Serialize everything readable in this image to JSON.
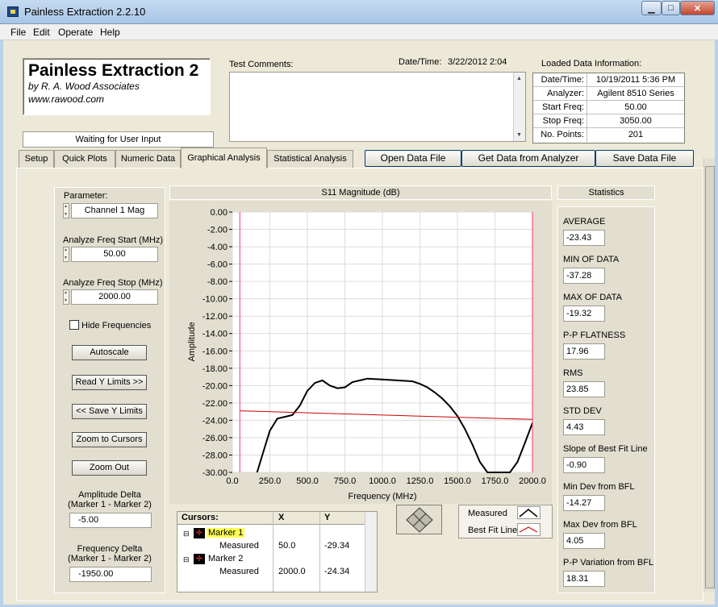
{
  "window": {
    "title": "Painless Extraction 2.2.10",
    "min_icon": "minimize-icon",
    "max_icon": "maximize-icon",
    "close_icon": "close-icon",
    "min": "▁",
    "max": "□",
    "close": "✕"
  },
  "menu": [
    "File",
    "Edit",
    "Operate",
    "Help"
  ],
  "brand": {
    "title": "Painless Extraction 2",
    "by": "by R. A. Wood Associates",
    "url": "www.rawood.com"
  },
  "status": "Waiting for User Input",
  "test_comments_label": "Test Comments:",
  "datetime": {
    "label": "Date/Time:",
    "value": "3/22/2012  2:04"
  },
  "loaded": {
    "label": "Loaded Data Information:",
    "rows": [
      {
        "k": "Date/Time:",
        "v": "10/19/2011 5:36 PM"
      },
      {
        "k": "Analyzer:",
        "v": "Agilent 8510 Series"
      },
      {
        "k": "Start Freq:",
        "v": "50.00"
      },
      {
        "k": "Stop Freq:",
        "v": "3050.00"
      },
      {
        "k": "No. Points:",
        "v": "201"
      }
    ]
  },
  "tabs": [
    "Setup",
    "Quick Plots",
    "Numeric Data",
    "Graphical Analysis",
    "Statistical Analysis"
  ],
  "active_tab": "Graphical Analysis",
  "buttons": {
    "open": "Open Data File",
    "get": "Get Data from Analyzer",
    "save": "Save Data File"
  },
  "left": {
    "parameter_label": "Parameter:",
    "parameter_value": "Channel 1 Mag",
    "start_label": "Analyze Freq Start (MHz)",
    "start_value": "50.00",
    "stop_label": "Analyze Freq Stop (MHz)",
    "stop_value": "2000.00",
    "hide_label": "Hide Frequencies",
    "autoscale": "Autoscale",
    "read_y": "Read Y Limits >>",
    "save_y": "<< Save Y Limits",
    "zoom_cursors": "Zoom to Cursors",
    "zoom_out": "Zoom Out",
    "amp_delta_label1": "Amplitude Delta",
    "amp_delta_label2": "(Marker 1 - Marker 2)",
    "amp_delta_value": "-5.00",
    "freq_delta_label1": "Frequency Delta",
    "freq_delta_label2": "(Marker 1 - Marker 2)",
    "freq_delta_value": "-1950.00"
  },
  "chart_data": {
    "type": "line",
    "title": "S11 Magnitude (dB)",
    "xlabel": "Frequency (MHz)",
    "ylabel": "Amplitude",
    "xlim": [
      0,
      2000
    ],
    "ylim": [
      -30,
      0
    ],
    "xticks": [
      "0.0",
      "250.0",
      "500.0",
      "750.0",
      "1000.0",
      "1250.0",
      "1500.0",
      "1750.0",
      "2000.0"
    ],
    "yticks": [
      "0.00",
      "-2.00",
      "-4.00",
      "-6.00",
      "-8.00",
      "-10.00",
      "-12.00",
      "-14.00",
      "-16.00",
      "-18.00",
      "-20.00",
      "-22.00",
      "-24.00",
      "-26.00",
      "-28.00",
      "-30.00"
    ],
    "grid": true,
    "series": [
      {
        "name": "Measured",
        "color": "#000000",
        "x": [
          165,
          200,
          250,
          300,
          350,
          400,
          450,
          500,
          550,
          600,
          650,
          700,
          750,
          800,
          850,
          900,
          1000,
          1100,
          1200,
          1250,
          1300,
          1350,
          1400,
          1450,
          1500,
          1550,
          1600,
          1650,
          1700,
          1750,
          1800,
          1850,
          1900,
          1950,
          2000
        ],
        "y": [
          -30,
          -28,
          -25.2,
          -23.8,
          -23.6,
          -23.4,
          -22.3,
          -20.6,
          -19.7,
          -19.4,
          -20,
          -20.3,
          -20.2,
          -19.6,
          -19.4,
          -19.2,
          -19.3,
          -19.4,
          -19.5,
          -19.8,
          -20.2,
          -20.8,
          -21.5,
          -22.4,
          -23.5,
          -25,
          -26.8,
          -28.8,
          -30,
          -30,
          -30,
          -30,
          -28.8,
          -26.6,
          -24.3
        ]
      },
      {
        "name": "Best Fit Line",
        "color": "#cc0000",
        "x": [
          50,
          2000
        ],
        "y": [
          -22.9,
          -23.9
        ]
      }
    ],
    "cursors": [
      {
        "name": "Marker 1",
        "x": 50,
        "y": -29.34
      },
      {
        "name": "Marker 2",
        "x": 2000,
        "y": -24.34
      }
    ]
  },
  "cursor_table": {
    "headers": [
      "Cursors:",
      "X",
      "Y"
    ],
    "rows": [
      {
        "name": "Marker 1",
        "sub": "Measured",
        "x": "50.0",
        "y": "-29.34"
      },
      {
        "name": "Marker 2",
        "sub": "Measured",
        "x": "2000.0",
        "y": "-24.34"
      }
    ]
  },
  "legend": [
    {
      "name": "Measured",
      "color": "#000000"
    },
    {
      "name": "Best Fit Line",
      "color": "#cc0000"
    }
  ],
  "stats": {
    "title": "Statistics",
    "items": [
      {
        "label": "AVERAGE",
        "value": "-23.43"
      },
      {
        "label": "MIN OF DATA",
        "value": "-37.28"
      },
      {
        "label": "MAX OF DATA",
        "value": "-19.32"
      },
      {
        "label": "P-P FLATNESS",
        "value": "17.96"
      },
      {
        "label": "RMS",
        "value": "23.85"
      },
      {
        "label": "STD DEV",
        "value": "4.43"
      },
      {
        "label": "Slope of Best Fit Line",
        "value": "-0.90"
      },
      {
        "label": "Min Dev from BFL",
        "value": "-14.27"
      },
      {
        "label": "Max Dev from BFL",
        "value": "4.05"
      },
      {
        "label": "P-P Variation from BFL",
        "value": "18.31"
      }
    ]
  }
}
